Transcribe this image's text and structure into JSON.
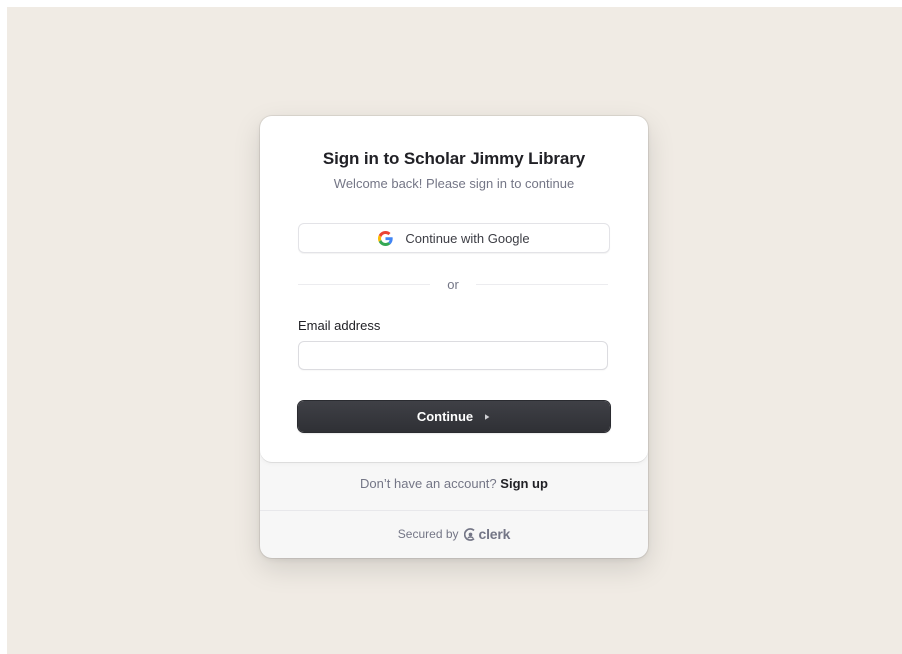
{
  "signin": {
    "title": "Sign in to Scholar Jimmy Library",
    "subtitle": "Welcome back! Please sign in to continue",
    "google_button_label": "Continue with Google",
    "divider_text": "or",
    "email_label": "Email address",
    "email_value": "",
    "email_placeholder": "",
    "continue_label": "Continue",
    "signup_prompt": "Don’t have an account?",
    "signup_link": "Sign up",
    "secured_by": "Secured by",
    "brand_name": "clerk"
  },
  "icons": {
    "google": "google-icon",
    "continue_arrow": "play-icon",
    "clerk": "clerk-logo-icon"
  },
  "colors": {
    "background": "#f0ebe4",
    "card": "#ffffff",
    "footer": "#f7f7f7",
    "primary_button": "#2f3035",
    "text_primary": "#212126",
    "text_secondary": "#747686"
  }
}
